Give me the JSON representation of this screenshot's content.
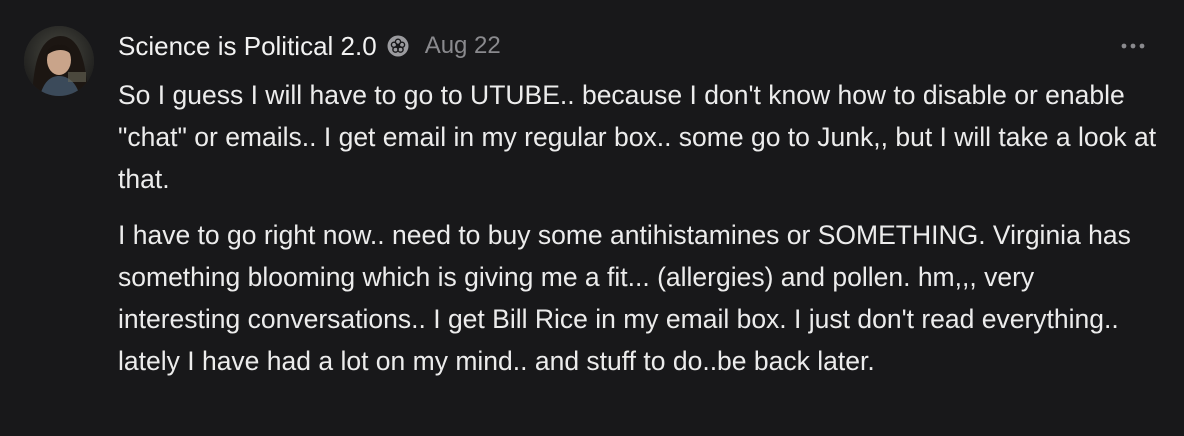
{
  "comment": {
    "author": "Science is Political 2.0",
    "badge_icon": "flower-badge-icon",
    "date": "Aug 22",
    "more_icon": "more-options-icon",
    "paragraphs": [
      "So I guess I will have to go to UTUBE.. because I don't know how to disable or enable \"chat\" or emails.. I get email in my regular box.. some go to Junk,, but I will take a look at that.",
      "I have to go right now.. need to buy some antihistamines or SOMETHING. Virginia has something blooming which is giving me a fit... (allergies) and pollen. hm,,, very interesting conversations.. I get Bill Rice in my email box. I just don't read everything.. lately I have had a lot on my mind.. and stuff to do..be back later."
    ]
  },
  "colors": {
    "background": "#18181a",
    "text": "#ececec",
    "muted": "#8a8a8e"
  }
}
